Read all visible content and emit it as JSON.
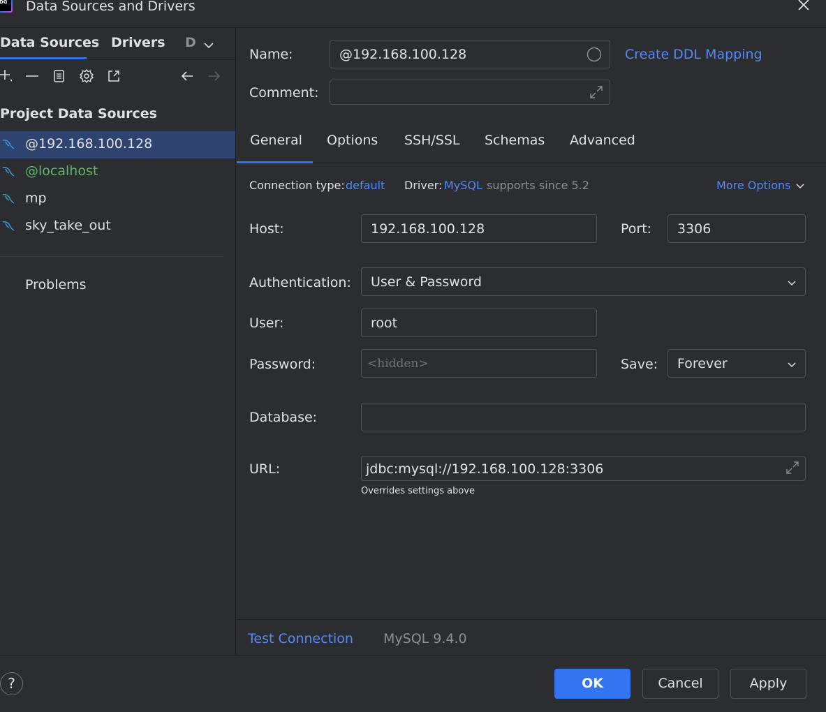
{
  "window": {
    "logo_text": "DG",
    "title": "Data Sources and Drivers"
  },
  "left": {
    "tabs": [
      "Data Sources",
      "Drivers",
      "D"
    ],
    "section_title": "Project Data Sources",
    "items": [
      {
        "label": "@192.168.100.128",
        "selected": true
      },
      {
        "label": "@localhost",
        "selected": false
      },
      {
        "label": "mp",
        "selected": false
      },
      {
        "label": "sky_take_out",
        "selected": false
      }
    ],
    "problems_label": "Problems"
  },
  "right": {
    "name_label": "Name:",
    "name_value": "@192.168.100.128",
    "create_ddl_link": "Create DDL Mapping",
    "comment_label": "Comment:",
    "comment_value": "",
    "tabs": [
      "General",
      "Options",
      "SSH/SSL",
      "Schemas",
      "Advanced"
    ],
    "active_tab": "General",
    "connection_type_label": "Connection type:",
    "connection_type_value": "default",
    "driver_label": "Driver:",
    "driver_value": "MySQL",
    "driver_note": "supports since 5.2",
    "more_options": "More Options",
    "host_label": "Host:",
    "host_value": "192.168.100.128",
    "port_label": "Port:",
    "port_value": "3306",
    "auth_label": "Authentication:",
    "auth_value": "User & Password",
    "user_label": "User:",
    "user_value": "root",
    "password_label": "Password:",
    "password_placeholder": "<hidden>",
    "save_label": "Save:",
    "save_value": "Forever",
    "database_label": "Database:",
    "database_value": "",
    "url_label": "URL:",
    "url_value": "jdbc:mysql://192.168.100.128:3306",
    "url_note": "Overrides settings above",
    "test_connection": "Test Connection",
    "server_version": "MySQL 9.4.0"
  },
  "buttons": {
    "help": "?",
    "ok": "OK",
    "cancel": "Cancel",
    "apply": "Apply"
  },
  "colors": {
    "background": "#2b2d30",
    "accent": "#3574f0",
    "link": "#548af7",
    "selection": "#2e436e",
    "localhost_green": "#5fb865"
  }
}
